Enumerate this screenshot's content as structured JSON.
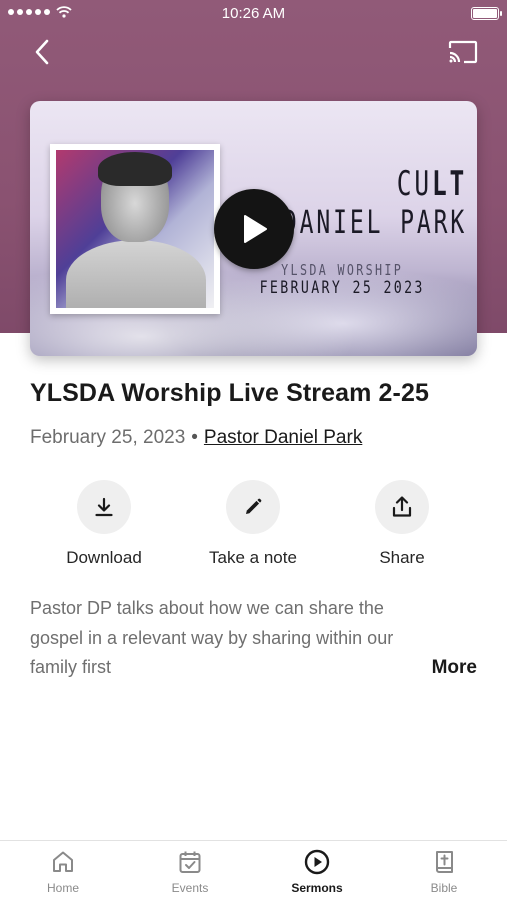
{
  "status_bar": {
    "time": "10:26 AM",
    "signal_icon": "signal-dots-icon",
    "wifi_icon": "wifi-icon",
    "battery_icon": "battery-icon",
    "battery_level": 1.0
  },
  "nav": {
    "back_icon": "chevron-left-icon",
    "cast_icon": "cast-icon"
  },
  "video": {
    "title_line1_light": "CU",
    "title_line1_bold": "LT",
    "title_line2": "PDANIEL PARK",
    "subtitle_line1": "YLSDA WORSHIP",
    "subtitle_line2": "FEBRUARY 25 2023",
    "play_icon": "play-icon"
  },
  "sermon": {
    "title": "YLSDA Worship Live Stream 2-25",
    "date": "February 25, 2023",
    "separator": "•",
    "speaker": "Pastor Daniel Park",
    "description": "Pastor DP talks about how we can share the gospel in a relevant way by sharing within our family first",
    "more_label": "More"
  },
  "actions": [
    {
      "label": "Download",
      "icon": "download-icon"
    },
    {
      "label": "Take a note",
      "icon": "pencil-icon"
    },
    {
      "label": "Share",
      "icon": "share-icon"
    }
  ],
  "tabs": [
    {
      "label": "Home",
      "icon": "home-icon",
      "active": false
    },
    {
      "label": "Events",
      "icon": "calendar-icon",
      "active": false
    },
    {
      "label": "Sermons",
      "icon": "play-circle-icon",
      "active": true
    },
    {
      "label": "Bible",
      "icon": "bible-icon",
      "active": false
    }
  ],
  "colors": {
    "hero_background": "#8a5271",
    "action_circle": "#efefef",
    "text_primary": "#1a1a1a",
    "text_secondary": "#6f6f6f",
    "tab_inactive": "#8a8a8a"
  }
}
